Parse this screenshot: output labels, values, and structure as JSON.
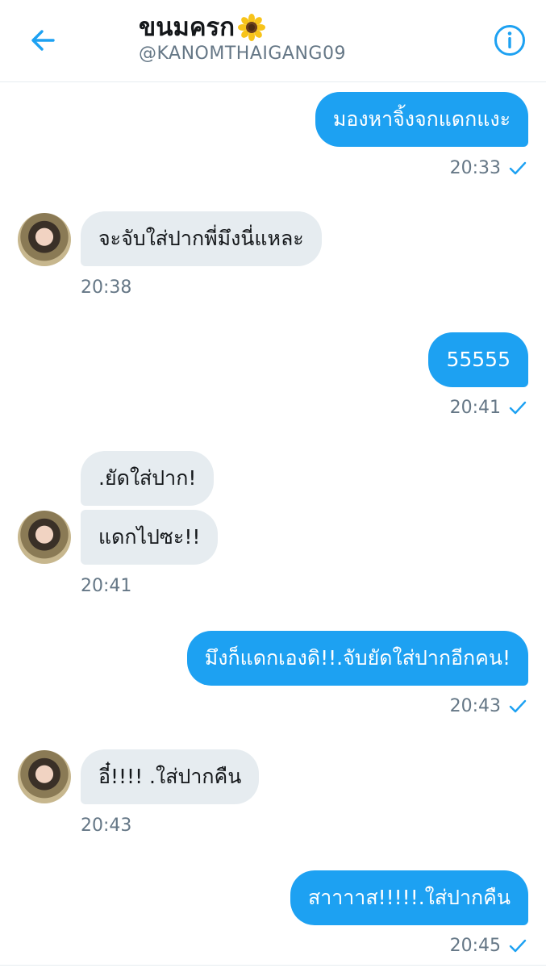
{
  "header": {
    "title": "ขนมครก",
    "title_emoji": "sunflower",
    "handle": "@KANOMTHAIGANG09"
  },
  "colors": {
    "accent": "#1da1f2",
    "incoming_bubble": "#e6ecf0",
    "muted_text": "#657786"
  },
  "messages": [
    {
      "direction": "out",
      "text": "มองหาจิ้งจกแดกแงะ",
      "time": "20:33",
      "status": "sent-check"
    },
    {
      "direction": "in",
      "text": "จะจับใส่ปากพี่มึงนี่แหละ",
      "time": "20:38"
    },
    {
      "direction": "out",
      "text": "55555",
      "time": "20:41",
      "status": "sent-check"
    },
    {
      "direction": "in",
      "text": ".ยัดใส่ปาก!"
    },
    {
      "direction": "in",
      "text": "แดกไปซะ!!",
      "time": "20:41"
    },
    {
      "direction": "out",
      "text": "มึงก็แดกเองดิ!!.จับยัดใส่ปากอีกคน!",
      "time": "20:43",
      "status": "sent-check"
    },
    {
      "direction": "in",
      "text": "อี๋!!!! .ใส่ปากคืน",
      "time": "20:43"
    },
    {
      "direction": "out",
      "text": "สาาาาส!!!!!.ใส่ปากคืน",
      "time": "20:45",
      "status": "sent-check"
    }
  ]
}
